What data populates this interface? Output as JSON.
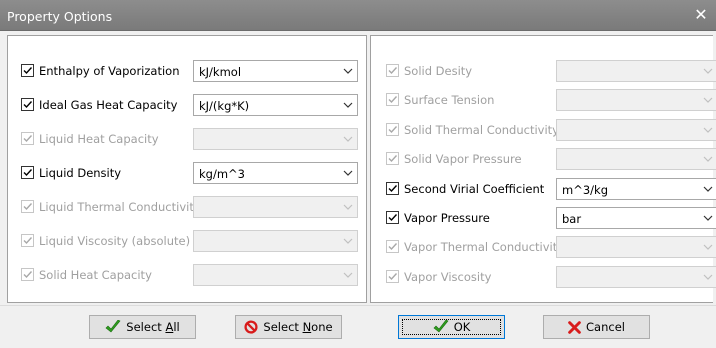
{
  "window": {
    "title": "Property Options",
    "close_glyph": "✕"
  },
  "left_rows": [
    {
      "label": "Enthalpy of Vaporization",
      "checked": true,
      "enabled": true,
      "unit": "kJ/kmol"
    },
    {
      "label": "Ideal Gas Heat Capacity",
      "checked": true,
      "enabled": true,
      "unit": "kJ/(kg*K)"
    },
    {
      "label": "Liquid Heat Capacity",
      "checked": true,
      "enabled": false,
      "unit": ""
    },
    {
      "label": "Liquid Density",
      "checked": true,
      "enabled": true,
      "unit": "kg/m^3"
    },
    {
      "label": "Liquid Thermal Conductivity",
      "checked": true,
      "enabled": false,
      "unit": ""
    },
    {
      "label": "Liquid Viscosity (absolute)",
      "checked": true,
      "enabled": false,
      "unit": ""
    },
    {
      "label": "Solid Heat Capacity",
      "checked": true,
      "enabled": false,
      "unit": ""
    }
  ],
  "right_rows": [
    {
      "label": "Solid Desity",
      "checked": true,
      "enabled": false,
      "unit": ""
    },
    {
      "label": "Surface Tension",
      "checked": true,
      "enabled": false,
      "unit": ""
    },
    {
      "label": "Solid Thermal Conductivity",
      "checked": true,
      "enabled": false,
      "unit": ""
    },
    {
      "label": "Solid Vapor Pressure",
      "checked": true,
      "enabled": false,
      "unit": ""
    },
    {
      "label": "Second Virial Coefficient",
      "checked": true,
      "enabled": true,
      "unit": "m^3/kg"
    },
    {
      "label": "Vapor Pressure",
      "checked": true,
      "enabled": true,
      "unit": "bar"
    },
    {
      "label": "Vapor Thermal Conductivity",
      "checked": true,
      "enabled": false,
      "unit": ""
    },
    {
      "label": "Vapor Viscosity",
      "checked": true,
      "enabled": false,
      "unit": ""
    }
  ],
  "buttons": {
    "select_all": {
      "label_pre": "Select ",
      "label_key": "A",
      "label_post": "ll",
      "icon": "green-check-icon"
    },
    "select_none": {
      "label_pre": "Select ",
      "label_key": "N",
      "label_post": "one",
      "icon": "red-no-icon"
    },
    "ok": {
      "label": "OK",
      "icon": "green-check-icon"
    },
    "cancel": {
      "label": "Cancel",
      "icon": "red-x-icon"
    }
  },
  "colors": {
    "check_green": "#2f9e1f",
    "no_red": "#d81b1b",
    "title_bar": "#838383",
    "focus_blue": "#0078d7"
  }
}
